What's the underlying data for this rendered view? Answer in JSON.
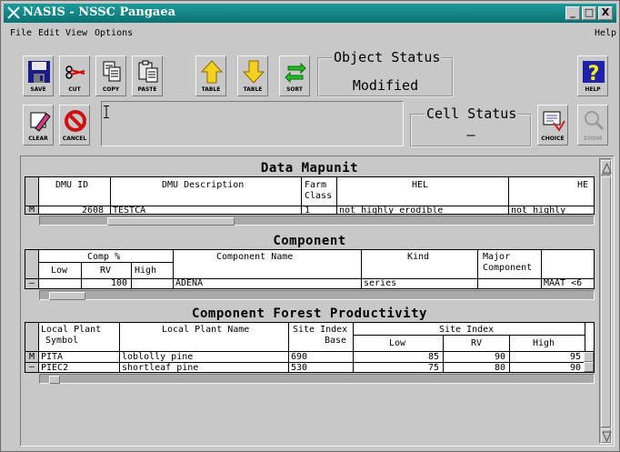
{
  "window": {
    "title": "NASIS - NSSC Pangaea",
    "buttons": [
      "_",
      "□",
      "X"
    ]
  },
  "menu": {
    "file": "File",
    "edit": "Edit",
    "view": "View",
    "options": "Options",
    "help": "Help"
  },
  "toolbar": {
    "save": "SAVE",
    "cut": "CUT",
    "copy": "COPY",
    "paste": "PASTE",
    "table_up": "TABLE",
    "table_down": "TABLE",
    "sort": "SORT",
    "help": "HELP",
    "clear": "CLEAR",
    "cancel": "CANCEL",
    "choice": "CHOICE",
    "zoom": "ZOOM"
  },
  "object_status": {
    "label": "Object Status",
    "value": "Modified"
  },
  "cell_status": {
    "label": "Cell Status",
    "value": "–"
  },
  "data_mapunit": {
    "title": "Data Mapunit",
    "headers": [
      "DMU ID",
      "DMU Description",
      "Farm",
      "Class",
      "HEL",
      "HE"
    ],
    "row": {
      "indicator": "M",
      "dmu_id": "2608",
      "description": "TESTCA",
      "farm_class": "1",
      "hel": "not highly erodible",
      "he": "not highly"
    }
  },
  "component": {
    "title": "Component",
    "headers": {
      "comp_pct": "Comp %",
      "low": "Low",
      "rv": "RV",
      "high": "High",
      "name": "Component Name",
      "kind": "Kind",
      "major1": "Major",
      "major2": "Component"
    },
    "row": {
      "indicator": "–",
      "rv": "100",
      "name": "ADENA",
      "kind": "series",
      "extra": "MAAT <6"
    }
  },
  "forest": {
    "title": "Component Forest Productivity",
    "headers": {
      "plant_symbol1": "Local Plant",
      "plant_symbol2": "Symbol",
      "plant_name": "Local Plant Name",
      "si_base1": "Site Index",
      "si_base2": "Base",
      "si": "Site Index",
      "low": "Low",
      "rv": "RV",
      "high": "High"
    },
    "rows": [
      {
        "indicator": "M",
        "symbol": "PITA",
        "name": "loblolly pine",
        "base": "690",
        "low": "85",
        "rv": "90",
        "high": "95"
      },
      {
        "indicator": "–",
        "symbol": "PIEC2",
        "name": "shortleaf pine",
        "base": "530",
        "low": "75",
        "rv": "80",
        "high": "90"
      }
    ]
  },
  "colors": {
    "title_bar": "#0b7272",
    "face": "#c8c8c8"
  }
}
